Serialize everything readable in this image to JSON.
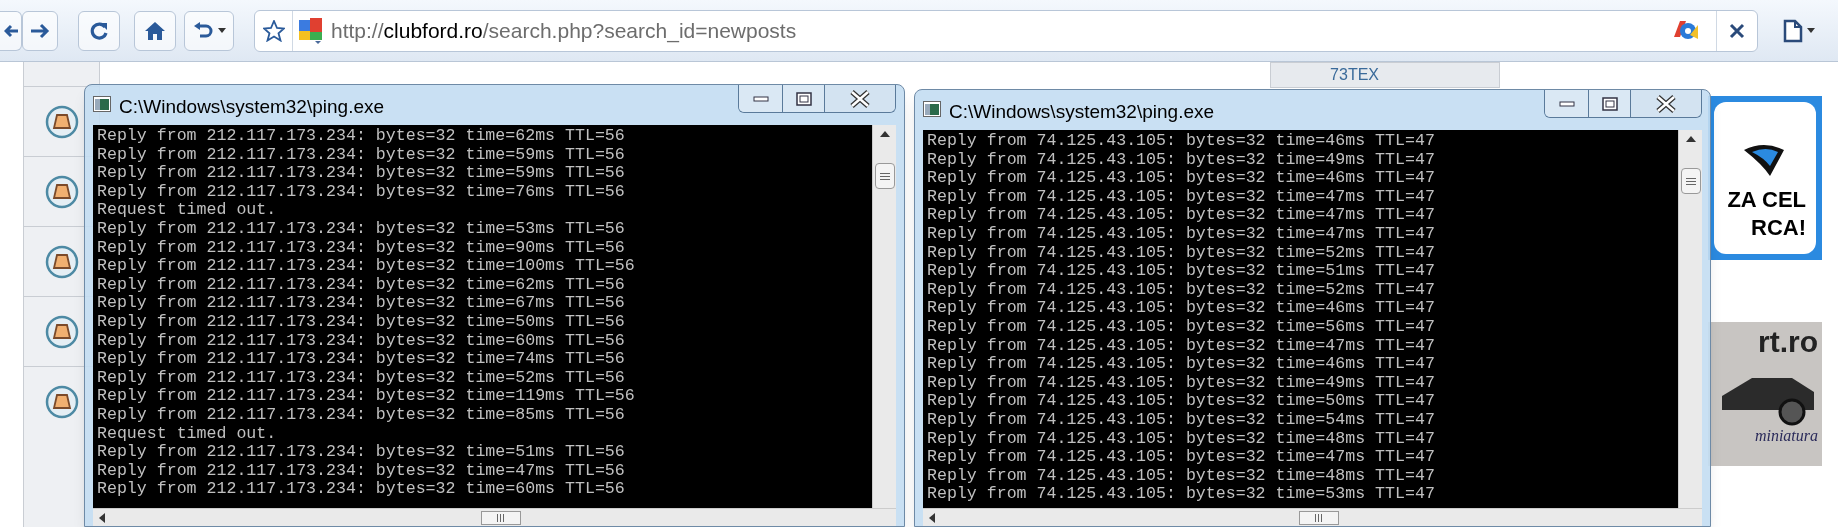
{
  "browser": {
    "address": {
      "scheme": "http://",
      "host": "clubford.ro",
      "path": "/search.php?search_id=newposts"
    }
  },
  "page": {
    "header_fragment": "73TEX",
    "ads": [
      {
        "kind": "insurance",
        "lines": [
          "ZA CEL",
          "RCA!"
        ]
      },
      {
        "kind": "models",
        "lines": [
          "rt.ro",
          "miniatura"
        ]
      }
    ]
  },
  "consoles": [
    {
      "title": "C:\\Windows\\system32\\ping.exe",
      "lines": [
        "Reply from 212.117.173.234: bytes=32 time=62ms TTL=56",
        "Reply from 212.117.173.234: bytes=32 time=59ms TTL=56",
        "Reply from 212.117.173.234: bytes=32 time=59ms TTL=56",
        "Reply from 212.117.173.234: bytes=32 time=76ms TTL=56",
        "Request timed out.",
        "Reply from 212.117.173.234: bytes=32 time=53ms TTL=56",
        "Reply from 212.117.173.234: bytes=32 time=90ms TTL=56",
        "Reply from 212.117.173.234: bytes=32 time=100ms TTL=56",
        "Reply from 212.117.173.234: bytes=32 time=62ms TTL=56",
        "Reply from 212.117.173.234: bytes=32 time=67ms TTL=56",
        "Reply from 212.117.173.234: bytes=32 time=50ms TTL=56",
        "Reply from 212.117.173.234: bytes=32 time=60ms TTL=56",
        "Reply from 212.117.173.234: bytes=32 time=74ms TTL=56",
        "Reply from 212.117.173.234: bytes=32 time=52ms TTL=56",
        "Reply from 212.117.173.234: bytes=32 time=119ms TTL=56",
        "Reply from 212.117.173.234: bytes=32 time=85ms TTL=56",
        "Request timed out.",
        "Reply from 212.117.173.234: bytes=32 time=51ms TTL=56",
        "Reply from 212.117.173.234: bytes=32 time=47ms TTL=56",
        "Reply from 212.117.173.234: bytes=32 time=60ms TTL=56"
      ]
    },
    {
      "title": "C:\\Windows\\system32\\ping.exe",
      "lines": [
        "Reply from 74.125.43.105: bytes=32 time=46ms TTL=47",
        "Reply from 74.125.43.105: bytes=32 time=49ms TTL=47",
        "Reply from 74.125.43.105: bytes=32 time=46ms TTL=47",
        "Reply from 74.125.43.105: bytes=32 time=47ms TTL=47",
        "Reply from 74.125.43.105: bytes=32 time=47ms TTL=47",
        "Reply from 74.125.43.105: bytes=32 time=47ms TTL=47",
        "Reply from 74.125.43.105: bytes=32 time=52ms TTL=47",
        "Reply from 74.125.43.105: bytes=32 time=51ms TTL=47",
        "Reply from 74.125.43.105: bytes=32 time=52ms TTL=47",
        "Reply from 74.125.43.105: bytes=32 time=46ms TTL=47",
        "Reply from 74.125.43.105: bytes=32 time=56ms TTL=47",
        "Reply from 74.125.43.105: bytes=32 time=47ms TTL=47",
        "Reply from 74.125.43.105: bytes=32 time=46ms TTL=47",
        "Reply from 74.125.43.105: bytes=32 time=49ms TTL=47",
        "Reply from 74.125.43.105: bytes=32 time=50ms TTL=47",
        "Reply from 74.125.43.105: bytes=32 time=54ms TTL=47",
        "Reply from 74.125.43.105: bytes=32 time=48ms TTL=47",
        "Reply from 74.125.43.105: bytes=32 time=47ms TTL=47",
        "Reply from 74.125.43.105: bytes=32 time=48ms TTL=47",
        "Reply from 74.125.43.105: bytes=32 time=53ms TTL=47"
      ]
    }
  ]
}
